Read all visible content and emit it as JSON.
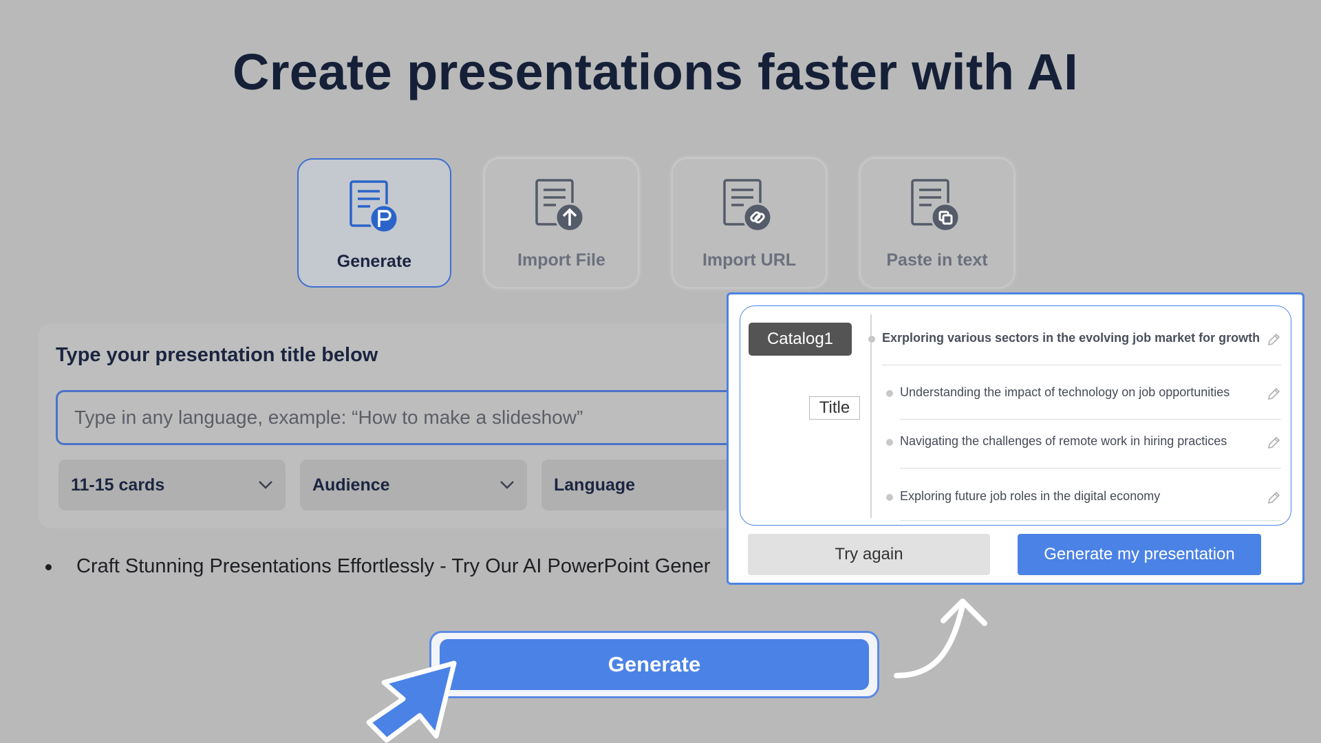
{
  "page": {
    "title": "Create presentations faster with AI"
  },
  "modes": [
    {
      "label": "Generate",
      "icon": "document-p-icon",
      "active": true
    },
    {
      "label": "Import File",
      "icon": "document-upload-icon",
      "active": false
    },
    {
      "label": "Import URL",
      "icon": "document-link-icon",
      "active": false
    },
    {
      "label": "Paste in text",
      "icon": "document-paste-icon",
      "active": false
    }
  ],
  "form": {
    "heading": "Type your presentation title below",
    "input_placeholder": "Type in any language, example: “How to make a slideshow”",
    "selects": [
      {
        "value": "11-15 cards"
      },
      {
        "value": "Audience"
      },
      {
        "value": "Language"
      }
    ]
  },
  "bullet": {
    "text": "Craft Stunning Presentations Effortlessly - Try Our AI PowerPoint Gener"
  },
  "generate_button": {
    "label": "Generate"
  },
  "outline": {
    "catalog_label": "Catalog1",
    "title_label": "Title",
    "items": [
      "Exrploring various sectors in the evolving job market for growth",
      "Understanding the impact of technology on job opportunities",
      "Navigating the challenges of remote work in hiring practices",
      "Exploring future job roles in the digital economy"
    ],
    "try_again_label": "Try again",
    "generate_label": "Generate my presentation"
  },
  "colors": {
    "accent": "#4b82e6",
    "background": "#b9b9b9",
    "title": "#152038"
  }
}
